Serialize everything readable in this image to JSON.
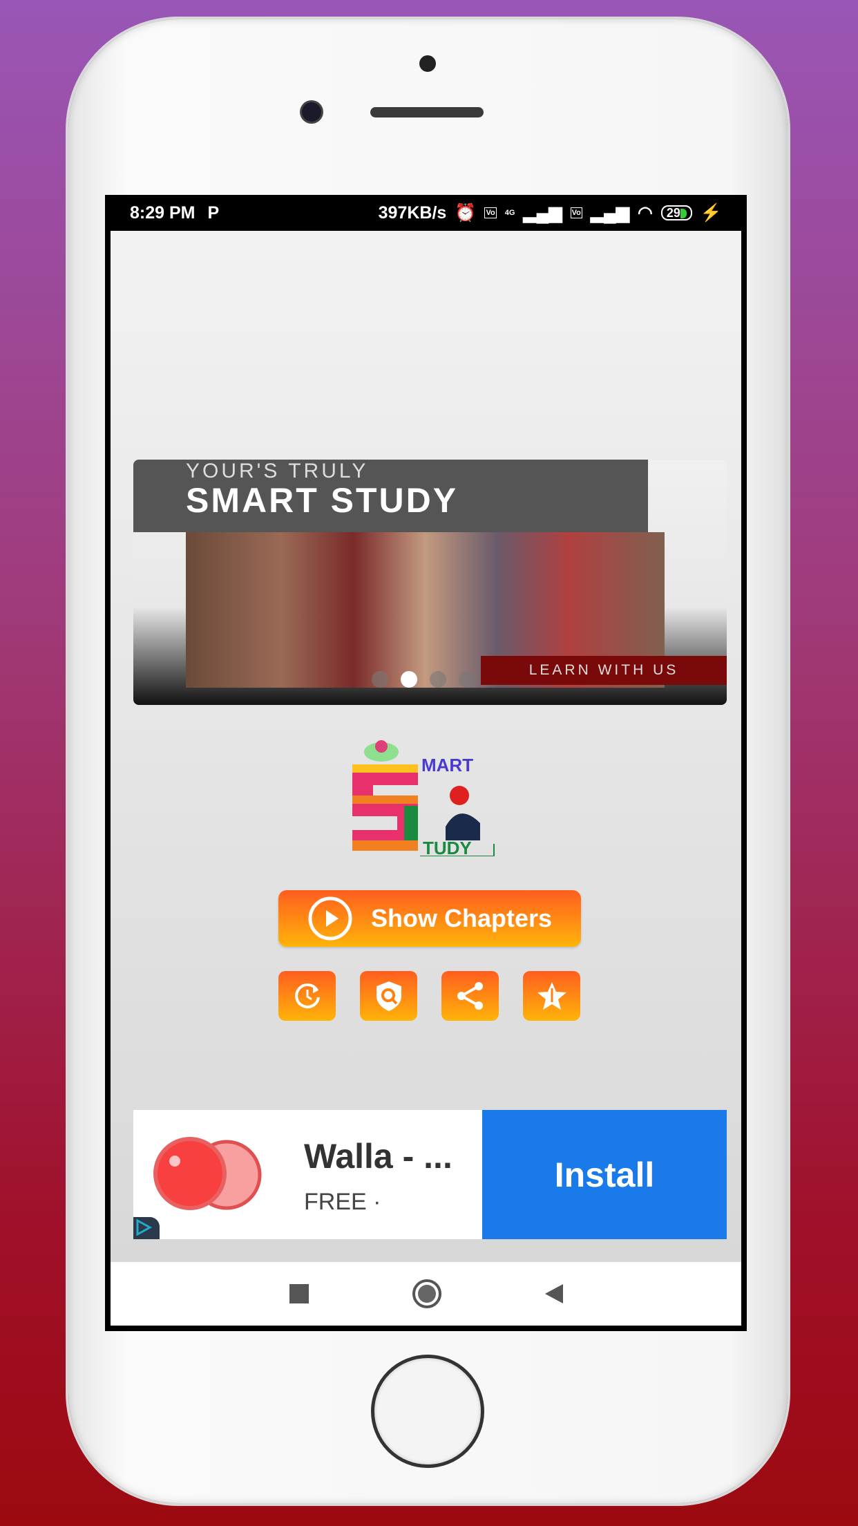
{
  "status_bar": {
    "time": "8:29 PM",
    "notif_icon": "P",
    "speed": "397KB/s",
    "net_badge": "4G",
    "battery": "29"
  },
  "banner": {
    "subtitle": "YOUR'S TRULY",
    "title": "SMART STUDY",
    "tagline": "LEARN WITH US",
    "slides": 4,
    "active_slide": 2
  },
  "logo": {
    "text_top": "MART",
    "text_bottom": "TUDY",
    "letter": "S"
  },
  "main": {
    "show_chapters": "Show Chapters",
    "icons": [
      "history-icon",
      "privacy-search-icon",
      "share-icon",
      "rate-star-icon"
    ]
  },
  "ad": {
    "title": "Walla - ...",
    "subtitle": "FREE ·",
    "install": "Install"
  },
  "colors": {
    "accent_top": "#ff5e1e",
    "accent_bottom": "#ffb40a",
    "install_blue": "#1a7aea"
  }
}
